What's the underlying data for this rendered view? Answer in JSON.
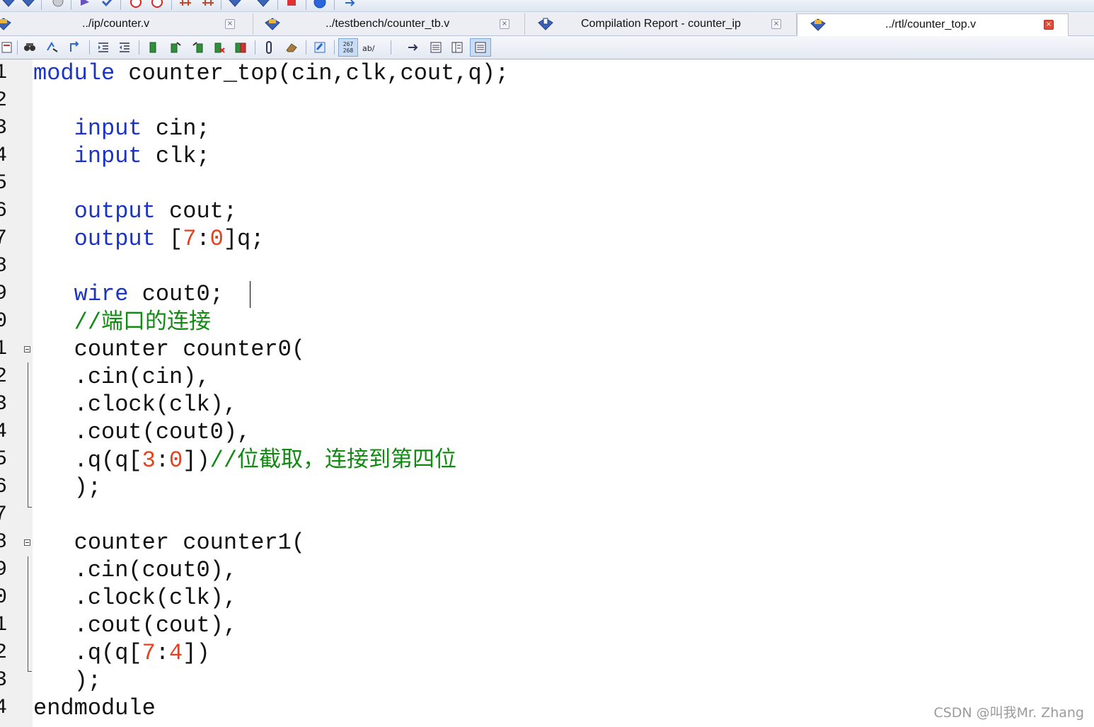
{
  "tabs": [
    {
      "label": "../ip/counter.v",
      "active": false,
      "close": "×"
    },
    {
      "label": "../testbench/counter_tb.v",
      "active": false,
      "close": "×"
    },
    {
      "label": "Compilation Report - counter_ip",
      "active": false,
      "close": "×"
    },
    {
      "label": "../rtl/counter_top.v",
      "active": true,
      "close": "×"
    }
  ],
  "toolbar": {
    "line_numbers_glyph": "267\n268",
    "abc_glyph": "ab/"
  },
  "editor": {
    "line_numbers": [
      "1",
      "2",
      "3",
      "4",
      "5",
      "6",
      "7",
      "8",
      "9",
      "0",
      "1",
      "2",
      "3",
      "4",
      "5",
      "6",
      "7",
      "8",
      "9",
      "0",
      "1",
      "2",
      "3",
      "4"
    ],
    "code": {
      "l1": {
        "kw": "module",
        "rest": " counter_top(cin,clk,cout,q);"
      },
      "l3": {
        "kw": "input",
        "rest": " cin;"
      },
      "l4": {
        "kw": "input",
        "rest": " clk;"
      },
      "l6": {
        "kw": "output",
        "rest": " cout;"
      },
      "l7": {
        "kw": "output",
        "rest1": " [",
        "n1": "7",
        "colon": ":",
        "n2": "0",
        "rest2": "]q;"
      },
      "l9": {
        "kw": "wire",
        "rest": " cout0;"
      },
      "l10": {
        "slash": "//",
        "cjk": "端口的连接"
      },
      "l11": {
        "text": "counter counter0("
      },
      "l12": {
        "text": ".cin(cin),"
      },
      "l13": {
        "text": ".clock(clk),"
      },
      "l14": {
        "text": ".cout(cout0),"
      },
      "l15": {
        "pre": ".q(q[",
        "n1": "3",
        "colon": ":",
        "n2": "0",
        "post": "])",
        "slash": "//",
        "cjk": "位截取，连接到第四位"
      },
      "l16": {
        "text": ");"
      },
      "l18": {
        "text": "counter counter1("
      },
      "l19": {
        "text": ".cin(cout0),"
      },
      "l20": {
        "text": ".clock(clk),"
      },
      "l21": {
        "text": ".cout(cout),"
      },
      "l22": {
        "pre": ".q(q[",
        "n1": "7",
        "colon": ":",
        "n2": "4",
        "post": "])"
      },
      "l23": {
        "text": ");"
      },
      "l24": {
        "kw": "endmodule"
      }
    }
  },
  "watermark": "CSDN @叫我Mr. Zhang",
  "colors": {
    "keyword": "#1a33c8",
    "number": "#e8401c",
    "comment": "#108a10",
    "gutter": "#f0f0f0"
  }
}
